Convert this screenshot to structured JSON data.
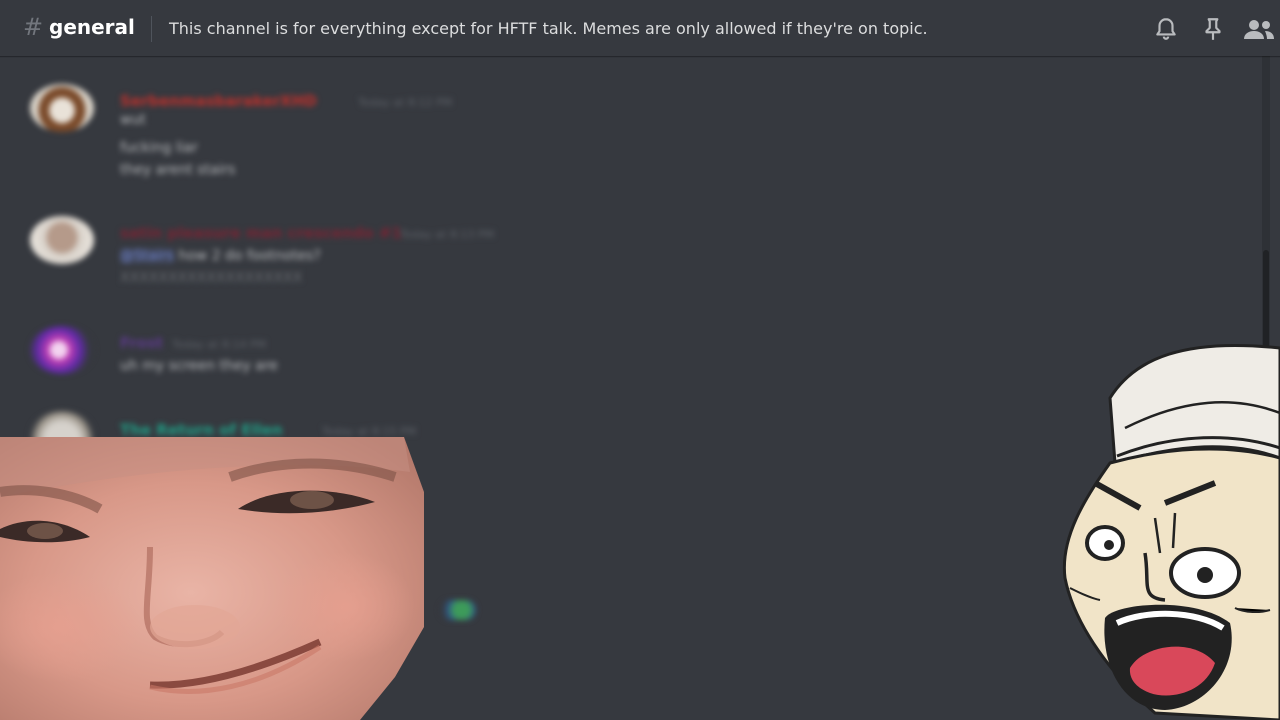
{
  "header": {
    "hash": "#",
    "channel_name": "general",
    "topic": "This channel is for everything except for HFTF talk. Memes are only allowed if they're on topic.",
    "icons": [
      "bell-icon",
      "pin-icon",
      "members-icon"
    ]
  },
  "messages": [
    {
      "author": "SerbenmasbarakerXHD",
      "author_color": "#c0302b",
      "time": "Today at 8:12 PM",
      "lines": [
        "wut",
        "fucking liar",
        "they arent stairs"
      ]
    },
    {
      "author": "satin pleasure man crescendo #1",
      "author_color": "#7a2333",
      "time": "Today at 8:13 PM",
      "mention": "@Stairs",
      "lines": [
        "how 2 do footnotes?",
        "XXXXXXXXXXXXXXXXXXX"
      ]
    },
    {
      "author": "Frost",
      "author_color": "#5b3a88",
      "time": "Today at 8:14 PM",
      "lines": [
        "uh my screen they are"
      ]
    },
    {
      "author": "The Return of Ellen",
      "author_color": "#1f9f86",
      "time": "Today at 8:15 PM",
      "lines": []
    }
  ],
  "overlays": {
    "left": "smug-face-photo",
    "right": "shocked-cartoon-man"
  },
  "colors": {
    "background": "#36393f",
    "header_text": "#ffffff",
    "topic_text": "#dcddde",
    "icon": "#b9bbbe"
  }
}
